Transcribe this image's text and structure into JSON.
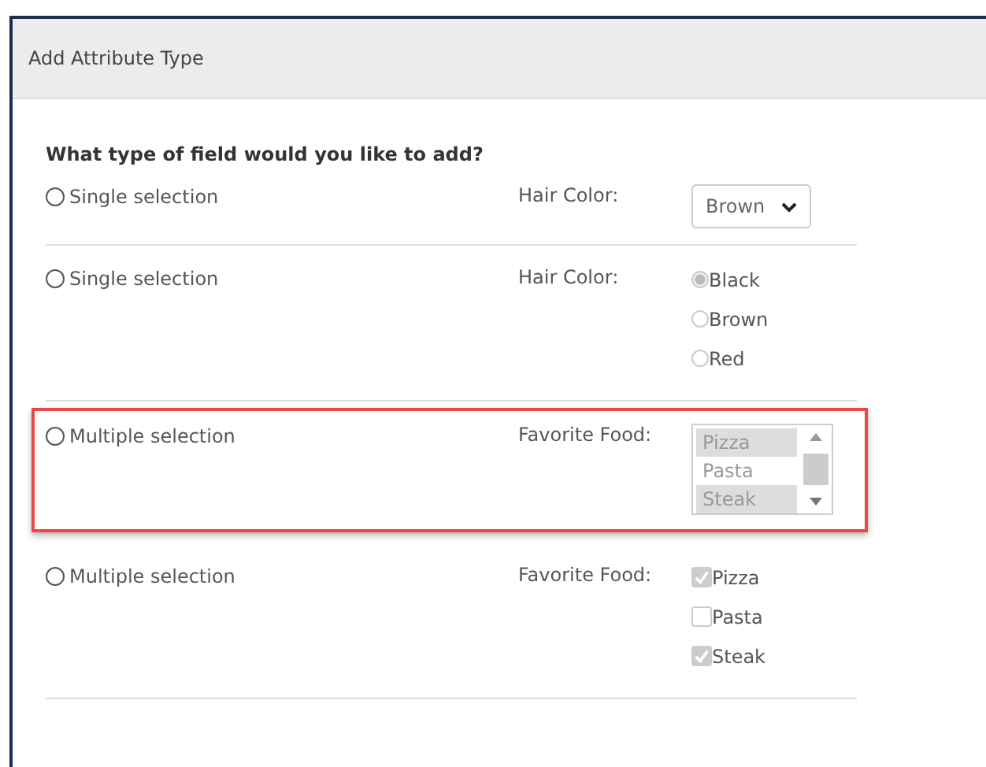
{
  "dialog": {
    "title": "Add Attribute Type"
  },
  "question": "What type of field would you like to add?",
  "rows": [
    {
      "kind": "dropdown",
      "label": "Single selection",
      "selected": false,
      "highlighted": false,
      "field_label": "Hair Color:",
      "value": "Brown"
    },
    {
      "kind": "radio",
      "label": "Single selection",
      "selected": false,
      "highlighted": false,
      "field_label": "Hair Color:",
      "options": [
        {
          "label": "Black",
          "selected": true
        },
        {
          "label": "Brown",
          "selected": false
        },
        {
          "label": "Red",
          "selected": false
        }
      ]
    },
    {
      "kind": "listbox",
      "label": "Multiple selection",
      "selected": false,
      "highlighted": true,
      "field_label": "Favorite Food:",
      "options": [
        {
          "label": "Pizza",
          "selected": true
        },
        {
          "label": "Pasta",
          "selected": false
        },
        {
          "label": "Steak",
          "selected": true
        }
      ]
    },
    {
      "kind": "checkbox",
      "label": "Multiple selection",
      "selected": false,
      "highlighted": false,
      "field_label": "Favorite Food:",
      "options": [
        {
          "label": "Pizza",
          "checked": true
        },
        {
          "label": "Pasta",
          "checked": false
        },
        {
          "label": "Steak",
          "checked": true
        }
      ]
    }
  ]
}
